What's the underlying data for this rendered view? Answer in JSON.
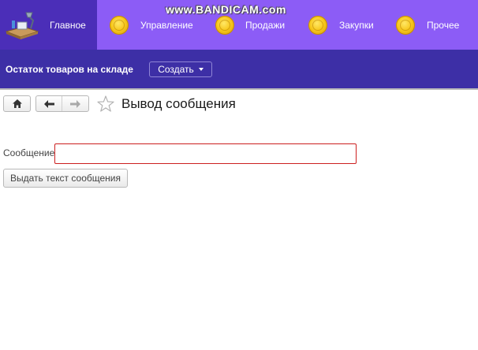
{
  "watermark": "www.BANDICAM.com",
  "sections": [
    {
      "label": "Главное",
      "icon": "desk-icon",
      "active": true
    },
    {
      "label": "Управление",
      "icon": "coin-icon"
    },
    {
      "label": "Продажи",
      "icon": "coin-icon"
    },
    {
      "label": "Закупки",
      "icon": "coin-icon"
    },
    {
      "label": "Прочее",
      "icon": "coin-icon"
    }
  ],
  "function_bar": {
    "title": "Остаток товаров на складе",
    "create_label": "Создать"
  },
  "form": {
    "title": "Вывод сообщения",
    "home_icon": "home-icon",
    "back_icon": "arrow-left-icon",
    "forward_icon": "arrow-right-icon",
    "favorite_icon": "star-outline-icon",
    "message_label": "Сообщение:",
    "message_value": "",
    "output_button_label": "Выдать текст сообщения"
  },
  "colors": {
    "sections_bg": "#8c5cf6",
    "active_section_bg": "#4b2eb8",
    "function_bar_bg": "#3d2fa6",
    "input_border": "#cc1f1f"
  }
}
